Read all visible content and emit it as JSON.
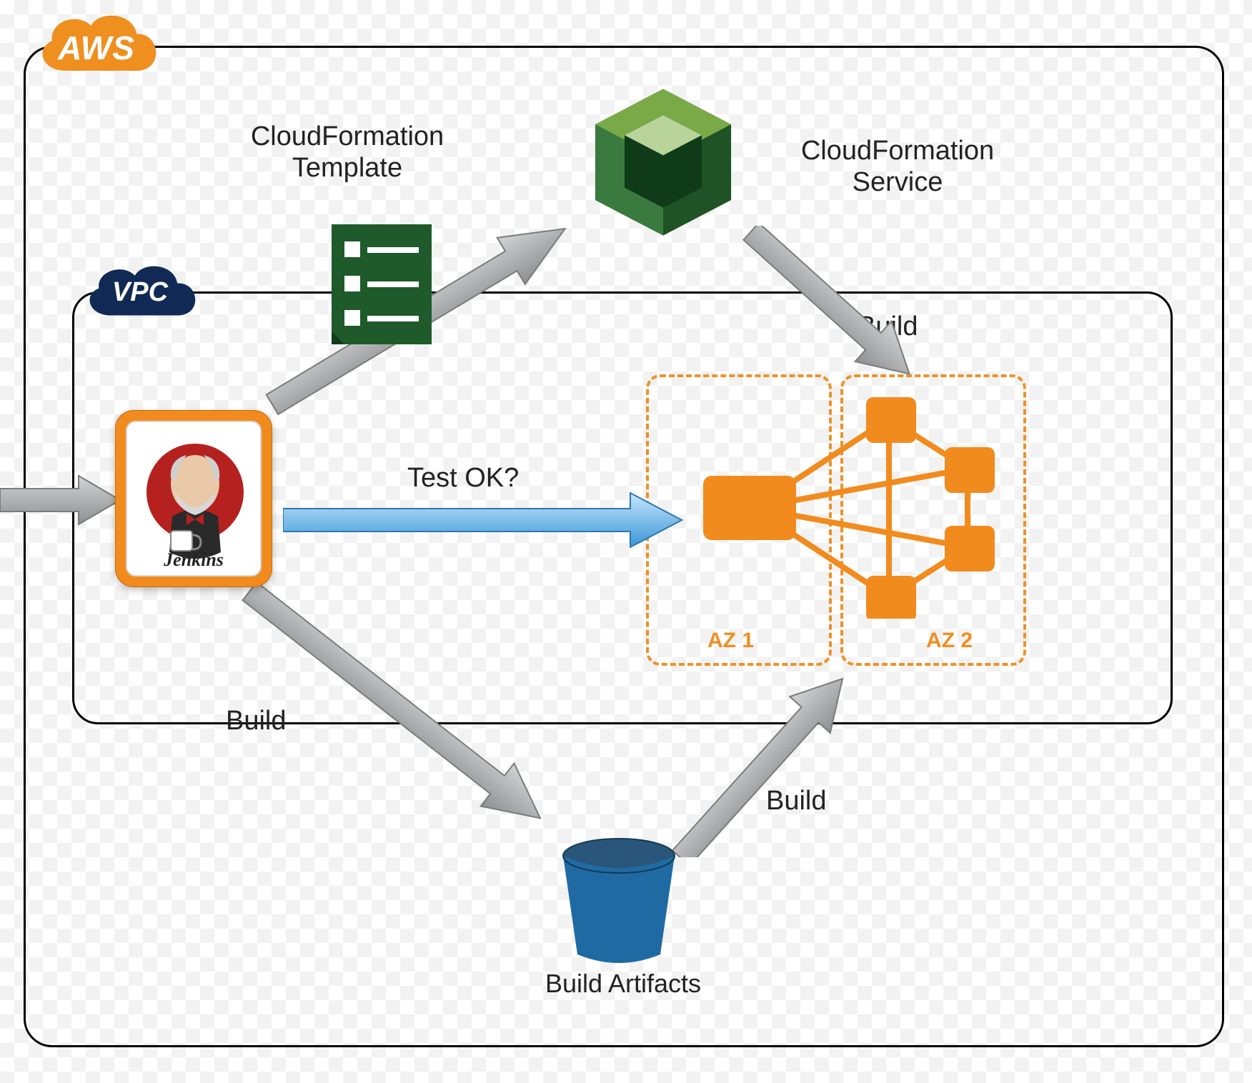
{
  "cloud": {
    "aws_label": "AWS",
    "vpc_label": "VPC"
  },
  "labels": {
    "cfn_template": "CloudFormation\nTemplate",
    "cfn_service": "CloudFormation\nService",
    "test_ok": "Test OK?",
    "build_top": "Build",
    "build_left": "Build",
    "build_right": "Build",
    "artifacts": "Build Artifacts",
    "az1": "AZ 1",
    "az2": "AZ 2",
    "jenkins": "Jenkins"
  },
  "colors": {
    "orange": "#f28b1e",
    "dark_green": "#1f5a2a",
    "green": "#6b9a3b",
    "blue_arrow_top": "#bfe3fb",
    "blue_arrow_bottom": "#3a96d8",
    "gray_arrow": "#a9aaab",
    "vpc_navy": "#112a55",
    "bucket_blue": "#1f6aa3"
  }
}
